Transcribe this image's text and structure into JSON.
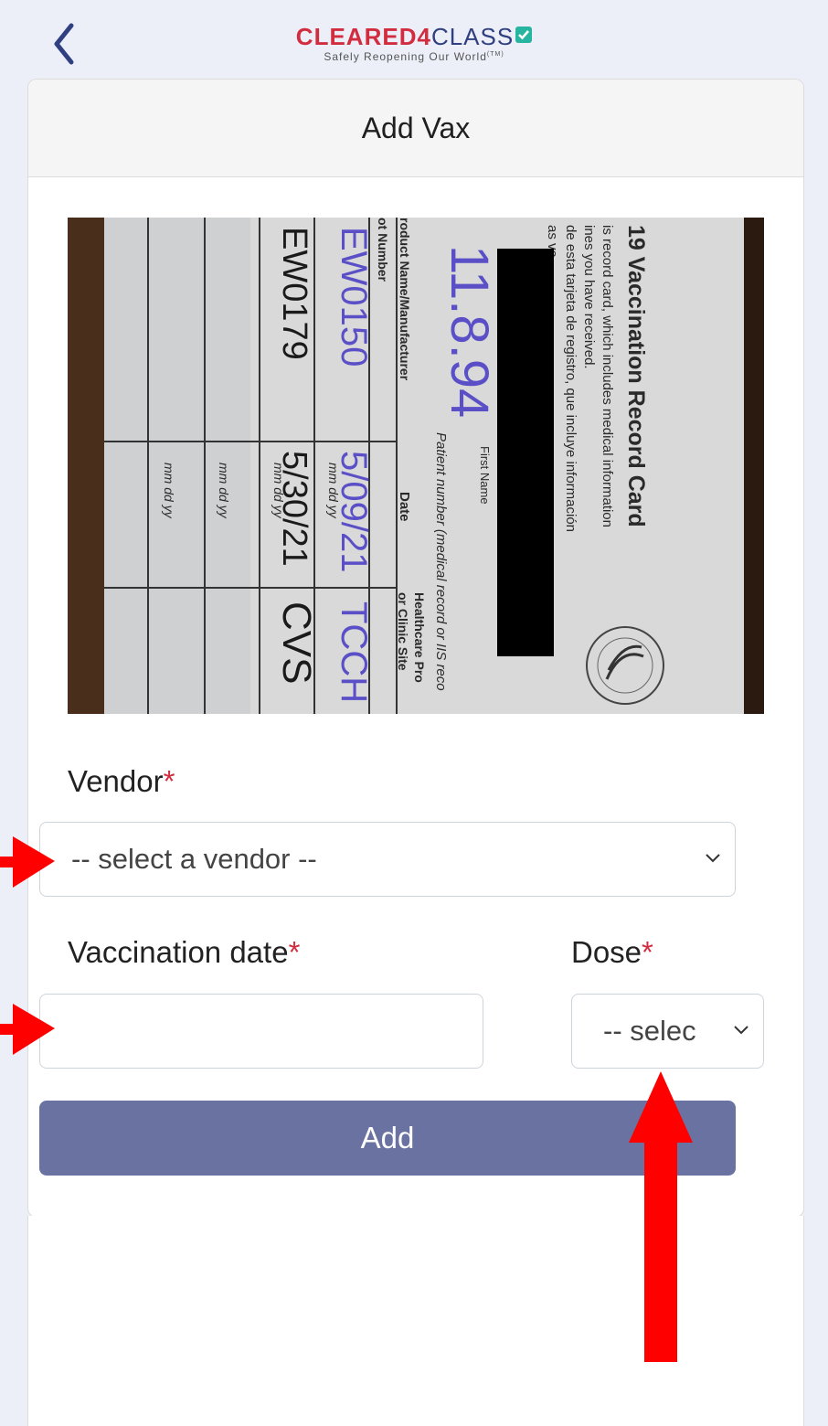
{
  "header": {
    "back_icon": "chevron-left-icon",
    "logo": {
      "part_red": "CLEARED4",
      "part_navy": "CLASS",
      "check_icon": "check-icon",
      "tagline": "Safely Reopening Our World",
      "tagline_mark": "(TM)"
    }
  },
  "card": {
    "title": "Add Vax"
  },
  "photo": {
    "card_heading": "19 Vaccination Record Card",
    "lines": [
      "is record card, which includes medical information",
      "ines you have received.",
      "de esta tarjeta de registro, que incluye información",
      "as va"
    ],
    "first_name_label": "First Name",
    "patient_number_label": "Patient number (medical record or IIS reco",
    "col_product": "roduct Name/Manufacturer",
    "col_lot": "ot Number",
    "col_date": "Date",
    "col_site_1": "Healthcare Pro",
    "col_site_2": "or Clinic Site",
    "date_placeholder": "mm dd yy",
    "handwriting": {
      "dob": "11.8.94",
      "lot_1": "EW0150",
      "lot_2": "EW0179",
      "date_1": "5/09/21",
      "date_2": "5/30/21",
      "site_1": "TCCH",
      "site_2": "CVS"
    }
  },
  "form": {
    "vendor_label": "Vendor",
    "vendor_required": "*",
    "vendor_placeholder": "-- select a vendor --",
    "date_label": "Vaccination date",
    "date_required": "*",
    "date_value": "",
    "dose_label": "Dose",
    "dose_required": "*",
    "dose_placeholder": "-- selec",
    "add_label": "Add"
  },
  "colors": {
    "background": "#eceef8",
    "brand_red": "#d22c3f",
    "brand_navy": "#2f3f80",
    "button": "#6a72a1",
    "annotation_arrow": "#ff0000"
  }
}
